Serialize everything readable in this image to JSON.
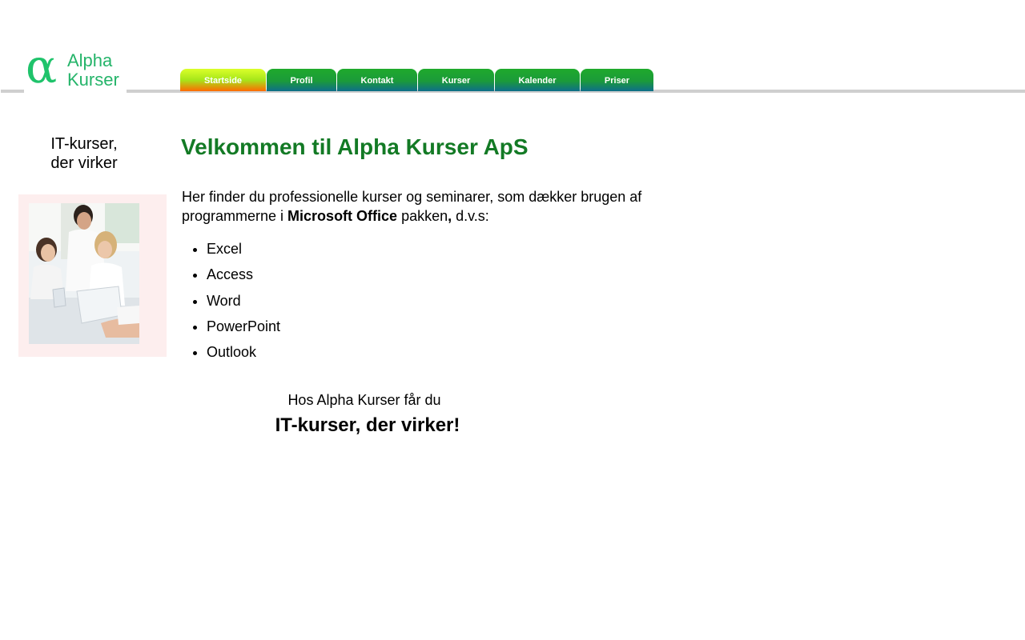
{
  "header": {
    "logo_glyph": "α",
    "logo_line1": "Alpha",
    "logo_line2": "Kurser",
    "nav": [
      {
        "label": "Startside",
        "active": true
      },
      {
        "label": "Profil",
        "active": false
      },
      {
        "label": "Kontakt",
        "active": false
      },
      {
        "label": "Kurser",
        "active": false
      },
      {
        "label": "Kalender",
        "active": false
      },
      {
        "label": "Priser",
        "active": false
      }
    ]
  },
  "sidebar": {
    "tagline_line1": "IT-kurser,",
    "tagline_line2": "der virker"
  },
  "main": {
    "title": "Velkommen til Alpha Kurser ApS",
    "intro_before": "Her finder du professionelle kurser og seminarer, som dækker brugen af programmerne i ",
    "intro_bold": "Microsoft Office",
    "intro_middle": " pakken",
    "intro_comma": ",",
    "intro_after": " d.v.s:",
    "programs": [
      "Excel",
      "Access",
      "Word",
      "PowerPoint",
      "Outlook"
    ],
    "closing_line1": "Hos Alpha Kurser får du",
    "closing_line2": "IT-kurser, der virker!"
  },
  "colors": {
    "title_green": "#137a25",
    "tab_green": "#1faa2c",
    "tab_active_top": "#dcff2a",
    "tab_active_bottom": "#ff6a00",
    "photo_box_bg": "#fdeeee",
    "logo_green": "#1fc36b"
  }
}
